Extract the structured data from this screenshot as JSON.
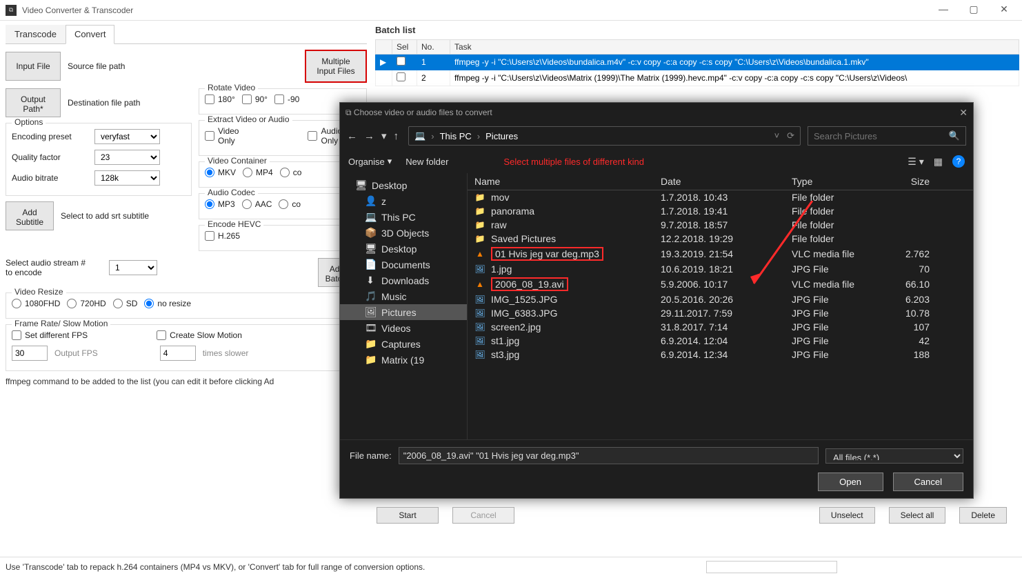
{
  "app": {
    "title": "Video Converter & Transcoder"
  },
  "window_controls": {
    "min": "—",
    "max": "▢",
    "close": "✕"
  },
  "tabs": {
    "transcode": "Transcode",
    "convert": "Convert"
  },
  "left": {
    "input_file_btn": "Input File",
    "source_lbl": "Source file path",
    "multiple_btn": "Multiple\nInput Files",
    "output_btn": "Output\nPath*",
    "dest_lbl": "Destination file path",
    "rotate_group": "Rotate Video",
    "rotate_180": "180°",
    "rotate_90": "90°",
    "rotate_m90": "-90",
    "extract_group": "Extract Video or Audio",
    "video_only": "Video\nOnly",
    "audio_only": "Audio\nOnly",
    "options_group": "Options",
    "enc_preset_lbl": "Encoding preset",
    "enc_preset_val": "veryfast",
    "quality_lbl": "Quality factor",
    "quality_val": "23",
    "audiobr_lbl": "Audio bitrate",
    "audiobr_val": "128k",
    "subtitle_btn": "Add\nSubtitle",
    "subtitle_lbl": "Select to add srt subtitle",
    "container_group": "Video Container",
    "mkv": "MKV",
    "mp4": "MP4",
    "co": "co",
    "codec_group": "Audio Codec",
    "mp3": "MP3",
    "aac": "AAC",
    "co2": "co",
    "hevc_group": "Encode HEVC",
    "h265": "H.265",
    "audio_stream_lbl": "Select audio stream #\nto encode",
    "audio_stream_val": "1",
    "add_to_batch": "Add To\nBatch Lis",
    "resize_group": "Video Resize",
    "r1080": "1080FHD",
    "r720": "720HD",
    "rsd": "SD",
    "rnone": "no resize",
    "fps_group": "Frame Rate/ Slow Motion",
    "set_fps": "Set different FPS",
    "create_slow": "Create Slow Motion",
    "fps_val": "30",
    "fps_lbl": "Output FPS",
    "slow_val": "4",
    "slow_lbl": "times slower",
    "cmd_lbl": "ffmpeg command to be added to the list (you can edit it before clicking Ad"
  },
  "batch": {
    "header": "Batch list",
    "columns": {
      "sel": "Sel",
      "no": "No.",
      "task": "Task"
    },
    "rows": [
      {
        "no": "1",
        "task": "ffmpeg -y -i \"C:\\Users\\z\\Videos\\bundalica.m4v\" -c:v copy -c:a copy -c:s copy \"C:\\Users\\z\\Videos\\bundalica.1.mkv\"",
        "selected": true
      },
      {
        "no": "2",
        "task": "ffmpeg -y -i \"C:\\Users\\z\\Videos\\Matrix (1999)\\The Matrix (1999).hevc.mp4\" -c:v copy -c:a copy -c:s copy \"C:\\Users\\z\\Videos\\",
        "selected": false
      }
    ]
  },
  "dialog": {
    "title": "Choose video or audio files to convert",
    "path": {
      "thispc": "This PC",
      "pictures": "Pictures"
    },
    "search_placeholder": "Search Pictures",
    "organise": "Organise",
    "newfolder": "New folder",
    "annotation": "Select multiple files of different kind",
    "tree": [
      {
        "label": "Desktop",
        "icon": "🖥",
        "lvl": 0
      },
      {
        "label": "z",
        "icon": "👤",
        "lvl": 1
      },
      {
        "label": "This PC",
        "icon": "💻",
        "lvl": 1
      },
      {
        "label": "3D Objects",
        "icon": "📦",
        "lvl": 1
      },
      {
        "label": "Desktop",
        "icon": "🖥",
        "lvl": 1
      },
      {
        "label": "Documents",
        "icon": "📄",
        "lvl": 1
      },
      {
        "label": "Downloads",
        "icon": "⬇",
        "lvl": 1
      },
      {
        "label": "Music",
        "icon": "🎵",
        "lvl": 1
      },
      {
        "label": "Pictures",
        "icon": "🖼",
        "lvl": 1,
        "selected": true
      },
      {
        "label": "Videos",
        "icon": "🎞",
        "lvl": 1
      },
      {
        "label": "Captures",
        "icon": "📁",
        "lvl": 1
      },
      {
        "label": "Matrix (19",
        "icon": "📁",
        "lvl": 1
      }
    ],
    "columns": {
      "name": "Name",
      "date": "Date",
      "type": "Type",
      "size": "Size"
    },
    "files": [
      {
        "icon": "folder",
        "name": "mov",
        "date": "1.7.2018. 10:43",
        "type": "File folder",
        "size": ""
      },
      {
        "icon": "folder",
        "name": "panorama",
        "date": "1.7.2018. 19:41",
        "type": "File folder",
        "size": ""
      },
      {
        "icon": "folder",
        "name": "raw",
        "date": "9.7.2018. 18:57",
        "type": "File folder",
        "size": ""
      },
      {
        "icon": "folder",
        "name": "Saved Pictures",
        "date": "12.2.2018. 19:29",
        "type": "File folder",
        "size": ""
      },
      {
        "icon": "vlc",
        "name": "01 Hvis jeg var deg.mp3",
        "date": "19.3.2019. 21:54",
        "type": "VLC media file",
        "size": "2.762",
        "selected": true
      },
      {
        "icon": "img",
        "name": "1.jpg",
        "date": "10.6.2019. 18:21",
        "type": "JPG File",
        "size": "70"
      },
      {
        "icon": "vlc",
        "name": "2006_08_19.avi",
        "date": "5.9.2006. 10:17",
        "type": "VLC media file",
        "size": "66.10",
        "selected": true
      },
      {
        "icon": "img",
        "name": "IMG_1525.JPG",
        "date": "20.5.2016. 20:26",
        "type": "JPG File",
        "size": "6.203"
      },
      {
        "icon": "img",
        "name": "IMG_6383.JPG",
        "date": "29.11.2017. 7:59",
        "type": "JPG File",
        "size": "10.78"
      },
      {
        "icon": "img",
        "name": "screen2.jpg",
        "date": "31.8.2017. 7:14",
        "type": "JPG File",
        "size": "107"
      },
      {
        "icon": "img",
        "name": "st1.jpg",
        "date": "6.9.2014. 12:04",
        "type": "JPG File",
        "size": "42"
      },
      {
        "icon": "img",
        "name": "st3.jpg",
        "date": "6.9.2014. 12:34",
        "type": "JPG File",
        "size": "188"
      }
    ],
    "filename_lbl": "File name:",
    "filename_val": "\"2006_08_19.avi\" \"01 Hvis jeg var deg.mp3\"",
    "filter": "All files (*.*)",
    "open": "Open",
    "cancel": "Cancel"
  },
  "bottom": {
    "start": "Start",
    "cancel": "Cancel",
    "unselect": "Unselect",
    "selectall": "Select all",
    "delete": "Delete"
  },
  "status": "Use 'Transcode' tab to repack h.264 containers (MP4 vs MKV), or 'Convert' tab for full range of conversion options."
}
